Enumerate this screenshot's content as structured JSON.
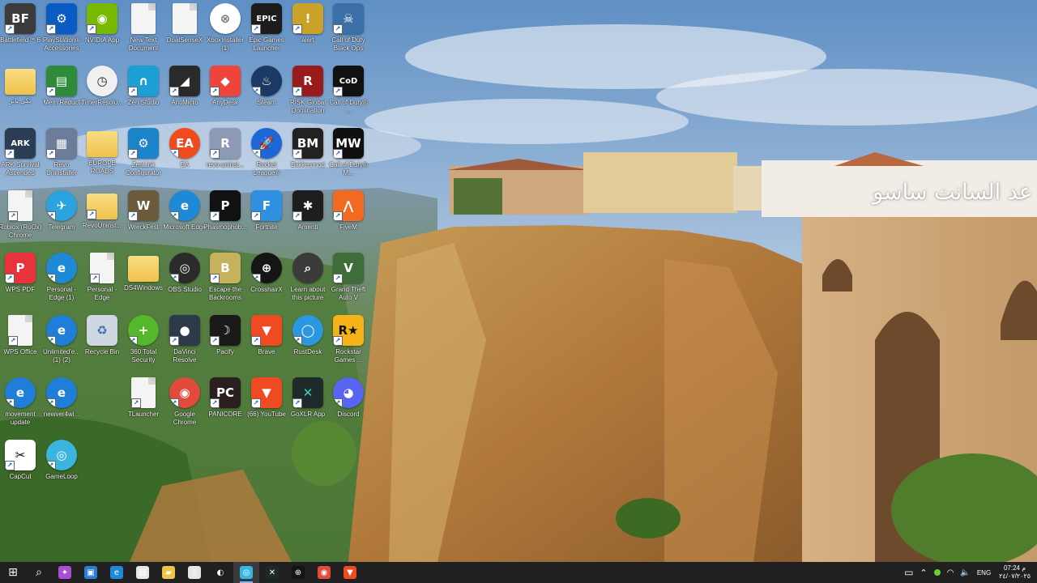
{
  "overlay_text": "عد السانت ساسو",
  "colors": {
    "taskbar": "#202020",
    "label_text": "#ffffff"
  },
  "icons": [
    {
      "label": "Battlefield™ 6",
      "name": "battlefield-icon",
      "bg": "#3b3b3b",
      "glyph": "BF",
      "shortcut": true
    },
    {
      "label": "PlayStation® Accessories",
      "name": "playstation-accessories-icon",
      "bg": "#0a5bc4",
      "glyph": "⚙",
      "shortcut": true
    },
    {
      "label": "NVIDIA App",
      "name": "nvidia-icon",
      "bg": "#76b900",
      "glyph": "◉",
      "shortcut": true
    },
    {
      "label": "New Text Document",
      "name": "text-document-icon",
      "kind": "file"
    },
    {
      "label": "DualSenseX",
      "name": "file-icon",
      "kind": "file"
    },
    {
      "label": "XboxInstaller (1)",
      "name": "xbox-icon",
      "bg": "#ffffff",
      "glyph": "⊗",
      "fg": "#777",
      "kind": "round"
    },
    {
      "label": "Epic Games Launcher",
      "name": "epic-games-icon",
      "bg": "#1c1c1c",
      "glyph": "EPIC",
      "shortcut": true
    },
    {
      "label": "alert",
      "name": "alert-icon",
      "bg": "#c9a227",
      "glyph": "!",
      "shortcut": true
    },
    {
      "label": "Call of Duty Black Ops",
      "name": "cod-black-ops-icon",
      "bg": "#3a6fa8",
      "glyph": "☠",
      "shortcut": true
    },
    {
      "label": "نكي بانر",
      "name": "folder-icon",
      "kind": "folder"
    },
    {
      "label": "Mem Reduct",
      "name": "mem-reduct-icon",
      "bg": "#2e8b3a",
      "glyph": "▤",
      "shortcut": true
    },
    {
      "label": "TimerResolu...",
      "name": "timer-resolution-icon",
      "bg": "#f0f0f0",
      "glyph": "◷",
      "fg": "#222",
      "kind": "round"
    },
    {
      "label": "Zen Studio",
      "name": "zen-studio-icon",
      "bg": "#1b9fd4",
      "glyph": "∩",
      "shortcut": true
    },
    {
      "label": "AntiMicro",
      "name": "antimicro-icon",
      "bg": "#2a2a2a",
      "glyph": "◢",
      "shortcut": true
    },
    {
      "label": "AnyDesk",
      "name": "anydesk-icon",
      "bg": "#ef443b",
      "glyph": "◆",
      "shortcut": true
    },
    {
      "label": "Steam",
      "name": "steam-icon",
      "bg": "#1b3a63",
      "glyph": "♨",
      "kind": "round",
      "shortcut": true
    },
    {
      "label": "RISK Global Domination",
      "name": "risk-icon",
      "bg": "#9a1b1b",
      "glyph": "R",
      "shortcut": true
    },
    {
      "label": "Call of Duty® ...",
      "name": "cod-icon",
      "bg": "#111111",
      "glyph": "CoD",
      "shortcut": true
    },
    {
      "label": "ARK Survival Ascended",
      "name": "ark-icon",
      "bg": "#2a3d55",
      "glyph": "ARK",
      "shortcut": true
    },
    {
      "label": "Revo Uninstaller",
      "name": "revo-uninstaller-icon",
      "bg": "#6c7d99",
      "glyph": "▦",
      "shortcut": true
    },
    {
      "label": "EUROPE ROADS",
      "name": "folder-icon",
      "kind": "folder"
    },
    {
      "label": "ZenLink Configurator",
      "name": "zenlink-icon",
      "bg": "#1b84c9",
      "glyph": "⚙",
      "shortcut": true
    },
    {
      "label": "EA",
      "name": "ea-icon",
      "bg": "#f04b1f",
      "glyph": "EA",
      "kind": "round",
      "shortcut": true
    },
    {
      "label": "revo-uninst...",
      "name": "revo-installer-icon",
      "bg": "#8c9ab5",
      "glyph": "R",
      "shortcut": true
    },
    {
      "label": "Rocket League®",
      "name": "rocket-league-icon",
      "bg": "#1d66d6",
      "glyph": "🚀",
      "kind": "round",
      "shortcut": true
    },
    {
      "label": "Bakkesmod",
      "name": "bakkesmod-icon",
      "bg": "#222",
      "glyph": "BM",
      "shortcut": true
    },
    {
      "label": "Call of Duty® M...",
      "name": "cod-mw3-icon",
      "bg": "#101010",
      "glyph": "MW",
      "shortcut": true
    },
    {
      "label": "Roblox (RoOx) Chrome",
      "name": "file-icon",
      "kind": "file",
      "shortcut": true
    },
    {
      "label": "Telegram",
      "name": "telegram-icon",
      "bg": "#2aa3df",
      "glyph": "✈",
      "kind": "round",
      "shortcut": true
    },
    {
      "label": "RevoUninst...",
      "name": "folder-icon",
      "kind": "folder",
      "shortcut": true
    },
    {
      "label": "WreckFest",
      "name": "wreckfest-icon",
      "bg": "#6b5a3c",
      "glyph": "W",
      "shortcut": true
    },
    {
      "label": "Microsoft Edge",
      "name": "edge-icon",
      "bg": "#1e8ad6",
      "glyph": "e",
      "kind": "round",
      "shortcut": true
    },
    {
      "label": "Phasmophob...",
      "name": "phasmophobia-icon",
      "bg": "#111",
      "glyph": "P",
      "shortcut": true
    },
    {
      "label": "Fortnite",
      "name": "fortnite-icon",
      "bg": "#2f8fe0",
      "glyph": "F",
      "shortcut": true
    },
    {
      "label": "Amenti",
      "name": "amenti-icon",
      "bg": "#1e1e1e",
      "glyph": "✱",
      "shortcut": true
    },
    {
      "label": "FiveM",
      "name": "fivem-icon",
      "bg": "#f26a21",
      "glyph": "⋀",
      "shortcut": true
    },
    {
      "label": "WPS PDF",
      "name": "wps-pdf-icon",
      "bg": "#e8323c",
      "glyph": "P",
      "shortcut": true
    },
    {
      "label": "Personal - Edge (1)",
      "name": "edge-profile-icon",
      "bg": "#1e8ad6",
      "glyph": "e",
      "kind": "round",
      "shortcut": true
    },
    {
      "label": "Personal - Edge",
      "name": "file-icon",
      "kind": "file",
      "shortcut": true
    },
    {
      "label": "DS4Windows",
      "name": "folder-icon",
      "kind": "folder"
    },
    {
      "label": "OBS Studio",
      "name": "obs-icon",
      "bg": "#2b2b2b",
      "glyph": "◎",
      "kind": "round",
      "shortcut": true
    },
    {
      "label": "Escape the Backrooms",
      "name": "escape-backrooms-icon",
      "bg": "#c5b25d",
      "glyph": "B",
      "shortcut": true
    },
    {
      "label": "CrosshairX",
      "name": "crosshairx-icon",
      "bg": "#151515",
      "glyph": "⊕",
      "kind": "round",
      "shortcut": true
    },
    {
      "label": "Learn about this picture",
      "name": "learn-picture-icon",
      "bg": "#3a3a3a",
      "glyph": "⌕",
      "kind": "round"
    },
    {
      "label": "Grand Theft Auto V",
      "name": "gta-v-icon",
      "bg": "#3f6d3a",
      "glyph": "V",
      "shortcut": true
    },
    {
      "label": "WPS Office",
      "name": "file-icon",
      "kind": "file",
      "shortcut": true
    },
    {
      "label": "Unlimited'e... (1) (2)",
      "name": "ie-icon",
      "bg": "#1f7fd8",
      "glyph": "e",
      "kind": "round",
      "shortcut": true
    },
    {
      "label": "Recycle Bin",
      "name": "recycle-bin-icon",
      "bg": "#cfd8e2",
      "glyph": "♻",
      "fg": "#3c6ea8"
    },
    {
      "label": "360 Total Security",
      "name": "360-security-icon",
      "bg": "#55b82c",
      "glyph": "+",
      "kind": "round",
      "shortcut": true
    },
    {
      "label": "DaVinci Resolve",
      "name": "davinci-resolve-icon",
      "bg": "#2d3a4a",
      "glyph": "●",
      "shortcut": true
    },
    {
      "label": "Pacify",
      "name": "pacify-icon",
      "bg": "#1a1a1a",
      "glyph": "☽",
      "shortcut": true
    },
    {
      "label": "Brave",
      "name": "brave-icon",
      "bg": "#f04a23",
      "glyph": "▼",
      "shortcut": true
    },
    {
      "label": "RustDesk",
      "name": "rustdesk-icon",
      "bg": "#2b97e0",
      "glyph": "◯",
      "kind": "round",
      "shortcut": true
    },
    {
      "label": "Rockstar Games ...",
      "name": "rockstar-icon",
      "bg": "#f6b318",
      "glyph": "R★",
      "fg": "#111",
      "shortcut": true
    },
    {
      "label": "movement update",
      "name": "ie-icon",
      "bg": "#1f7fd8",
      "glyph": "e",
      "kind": "round",
      "shortcut": true
    },
    {
      "label": "newver4wi...",
      "name": "ie-icon",
      "bg": "#1f7fd8",
      "glyph": "e",
      "kind": "round",
      "shortcut": true
    },
    {
      "label": "",
      "name": "empty-slot",
      "kind": "empty"
    },
    {
      "label": "TLauncher",
      "name": "file-icon",
      "kind": "file",
      "shortcut": true
    },
    {
      "label": "Google Chrome",
      "name": "chrome-icon",
      "bg": "#e24a3b",
      "glyph": "◉",
      "kind": "round",
      "shortcut": true
    },
    {
      "label": "PANICORE",
      "name": "panicore-icon",
      "bg": "#2a1e1e",
      "glyph": "PC",
      "shortcut": true
    },
    {
      "label": "(66) YouTube",
      "name": "youtube-icon",
      "bg": "#f04a23",
      "glyph": "▼",
      "shortcut": true
    },
    {
      "label": "GoXLR App",
      "name": "goxlr-icon",
      "bg": "#1e2a2a",
      "glyph": "✕",
      "fg": "#3fd0c0",
      "shortcut": true
    },
    {
      "label": "Discord",
      "name": "discord-icon",
      "bg": "#5865f2",
      "glyph": "◕",
      "kind": "round",
      "shortcut": true
    },
    {
      "label": "CapCut",
      "name": "capcut-icon",
      "bg": "#ffffff",
      "glyph": "✂",
      "fg": "#000",
      "shortcut": true
    },
    {
      "label": "GameLoop",
      "name": "gameloop-icon",
      "bg": "#3ab5e0",
      "glyph": "◎",
      "kind": "round",
      "shortcut": true
    }
  ],
  "taskbar": {
    "apps": [
      {
        "name": "start-button",
        "glyph": "⊞",
        "bg": "transparent"
      },
      {
        "name": "search-icon",
        "glyph": "⌕",
        "bg": "transparent"
      },
      {
        "name": "copilot-icon",
        "glyph": "✦",
        "bg": "#a84fd8"
      },
      {
        "name": "microsoft-store-icon",
        "glyph": "▣",
        "bg": "#2a7fd4"
      },
      {
        "name": "edge-taskbar-icon",
        "glyph": "e",
        "bg": "#1e8ad6"
      },
      {
        "name": "store-bag-icon",
        "glyph": "▤",
        "bg": "#e8e8e8"
      },
      {
        "name": "file-explorer-icon",
        "glyph": "▰",
        "bg": "#f1c348"
      },
      {
        "name": "notepad-icon",
        "glyph": "▯",
        "bg": "#e6e6e6"
      },
      {
        "name": "capture-icon",
        "glyph": "◐",
        "bg": "transparent"
      },
      {
        "name": "gameloop-taskbar-icon",
        "glyph": "◎",
        "bg": "#3ab5e0",
        "active": true
      },
      {
        "name": "goxlr-taskbar-icon",
        "glyph": "✕",
        "bg": "#1e2a2a"
      },
      {
        "name": "crosshair-taskbar-icon",
        "glyph": "⊕",
        "bg": "#151515"
      },
      {
        "name": "chrome-taskbar-icon",
        "glyph": "◉",
        "bg": "#e24a3b"
      },
      {
        "name": "brave-taskbar-icon",
        "glyph": "▼",
        "bg": "#f04a23"
      }
    ],
    "tray": {
      "notification": "▭",
      "chevron": "⌃",
      "lang": "ENG",
      "time": "07:24 م",
      "date": "٢٤/٠٧/٢٠٢٥"
    }
  }
}
